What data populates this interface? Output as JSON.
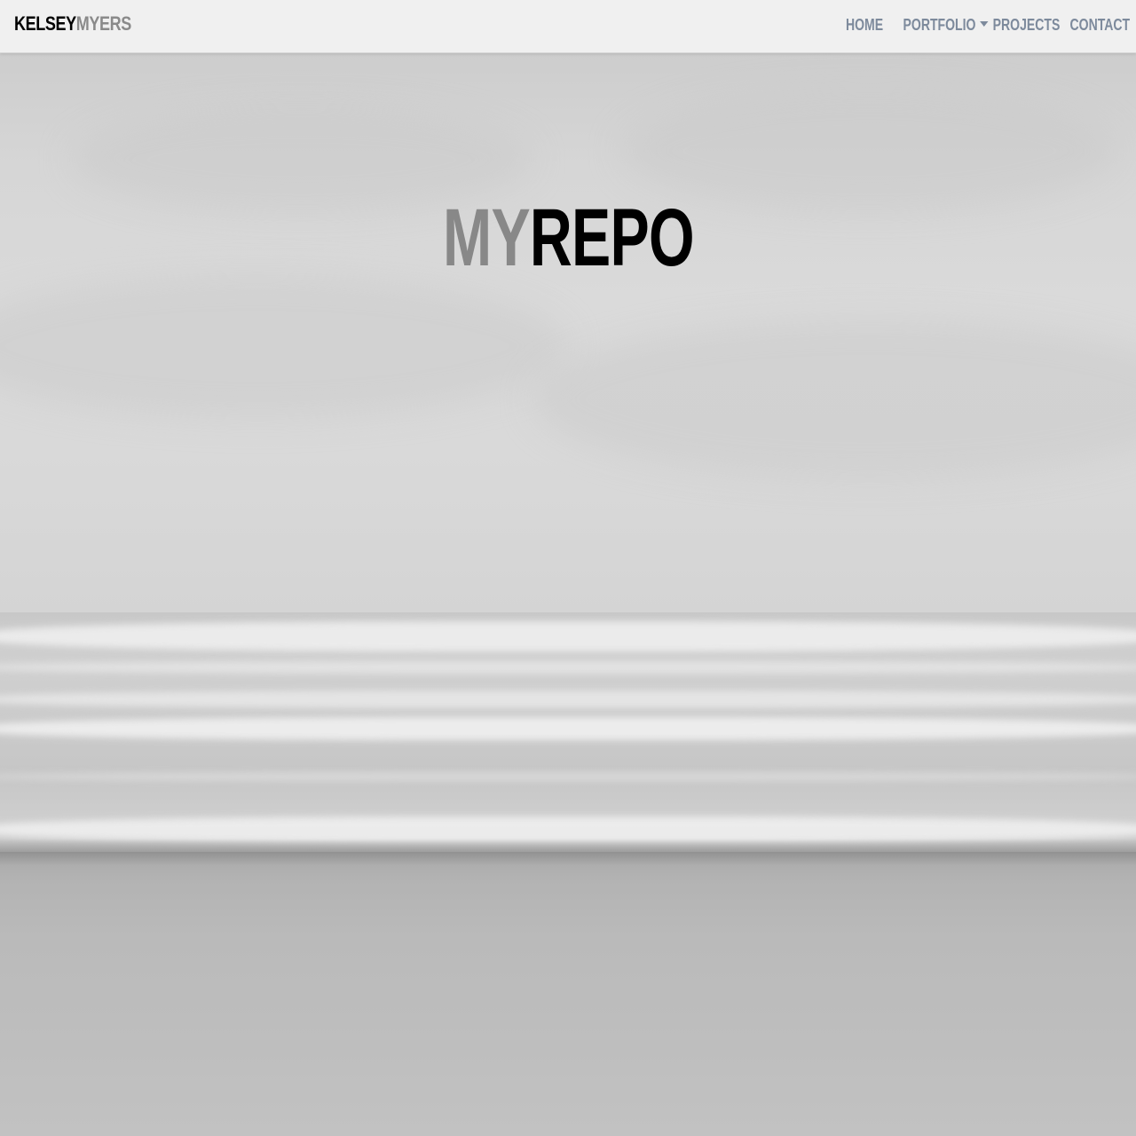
{
  "brand": {
    "first": "KELSEY",
    "last": "MYERS"
  },
  "nav": {
    "items": [
      {
        "label": "HOME"
      },
      {
        "label": "PORTFOLIO",
        "has_dropdown": true
      },
      {
        "label": "PROJECTS"
      },
      {
        "label": "CONTACT"
      }
    ]
  },
  "hero": {
    "title_part1": "MY",
    "title_part2": "REPO",
    "background": "grayscale beach with waves"
  },
  "colors": {
    "navbar_bg": "#f0f0f0",
    "nav_link": "#7d8a9c",
    "brand_primary": "#000000",
    "brand_secondary": "#8a8a8a",
    "title_primary": "#888888",
    "title_secondary": "#000000"
  }
}
